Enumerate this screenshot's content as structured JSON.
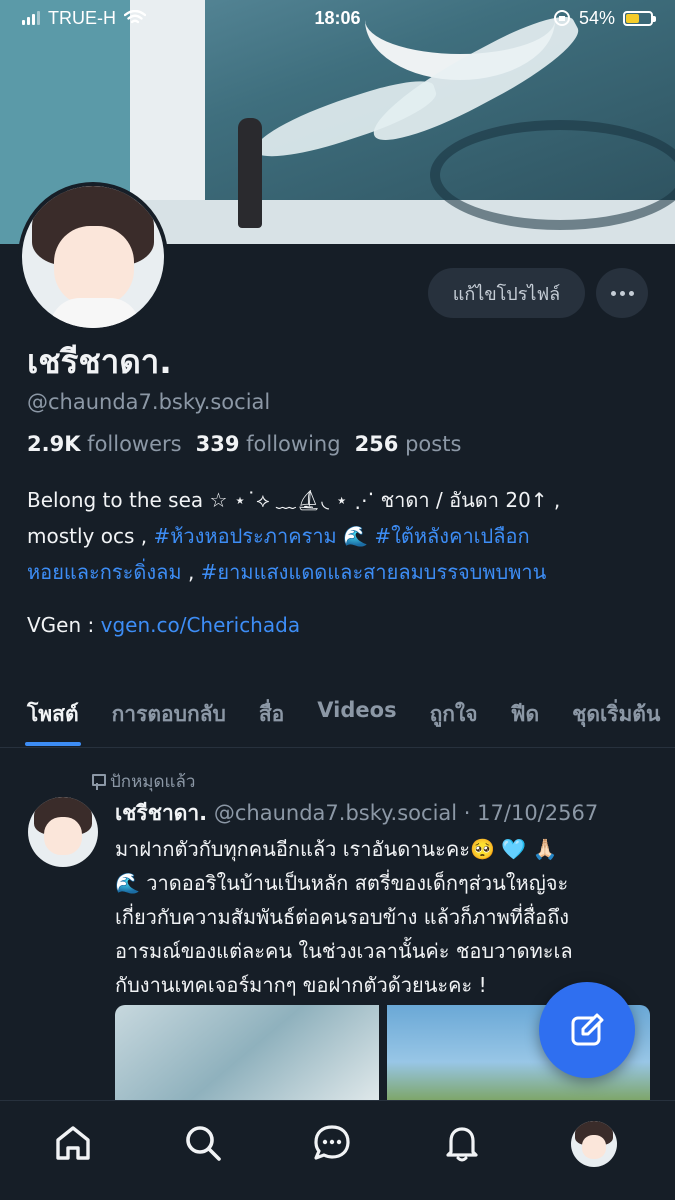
{
  "status_bar": {
    "carrier": "TRUE-H",
    "time": "18:06",
    "battery": "54%",
    "battery_level": 0.54
  },
  "profile": {
    "edit_button": "แก้ไขโปรไฟล์",
    "display_name": "เชรีชาดา.",
    "handle": "@chaunda7.bsky.social",
    "followers_count": "2.9K",
    "followers_label": "followers",
    "following_count": "339",
    "following_label": "following",
    "posts_count": "256",
    "posts_label": "posts"
  },
  "bio": {
    "line1": "Belong to the sea ☆ ⋆˙⟡ ﹏⛵︎◟ ⋆ ⋰ ชาดา / อันดา 20↑ ,",
    "line2_prefix": "mostly ocs , ",
    "tag1": "#ห้วงหอประภาคราม",
    "wave1": " 🌊 ",
    "tag2": "#ใต้หลังคาเปลือก",
    "tag2_cont": "หอยและกระดิ่งลม",
    "separator": " , ",
    "tag3": "#ยามแสงแดดและสายลมบรรจบพบพาน",
    "vgen_label": "VGen : ",
    "vgen_link": "vgen.co/Cherichada"
  },
  "tabs": [
    "โพสต์",
    "การตอบกลับ",
    "สื่อ",
    "Videos",
    "ถูกใจ",
    "ฟีด",
    "ชุดเริ่มต้น"
  ],
  "post": {
    "pinned_label": "ปักหมุดแล้ว",
    "author_name": "เชรีชาดา.",
    "author_handle": "@chaunda7.bsky.social",
    "date": "17/10/2567",
    "line1": "มาฝากตัวกับทุกคนอีกแล้ว เราอันดานะคะ🥺 🩵 🙏🏻",
    "line2": "🌊 วาดออริในบ้านเป็นหลัก สตรี่ของเด็กๆส่วนใหญ่จะ",
    "line3": "เกี่ยวกับความสัมพันธ์ต่อคนรอบข้าง แล้วก็ภาพที่สื่อถึง",
    "line4": "อารมณ์ของแต่ละคน ในช่วงเวลานั้นค่ะ ชอบวาดทะเล",
    "line5": "กับงานเทคเจอร์มากๆ ขอฝากตัวด้วยนะคะ !"
  },
  "colors": {
    "background": "#161e27",
    "accent": "#3d8df5",
    "fab": "#2f6ff0",
    "muted": "#8c98a6"
  },
  "icons": [
    "home-icon",
    "search-icon",
    "chat-icon",
    "bell-icon",
    "compose-icon",
    "pin-icon",
    "more-icon"
  ]
}
